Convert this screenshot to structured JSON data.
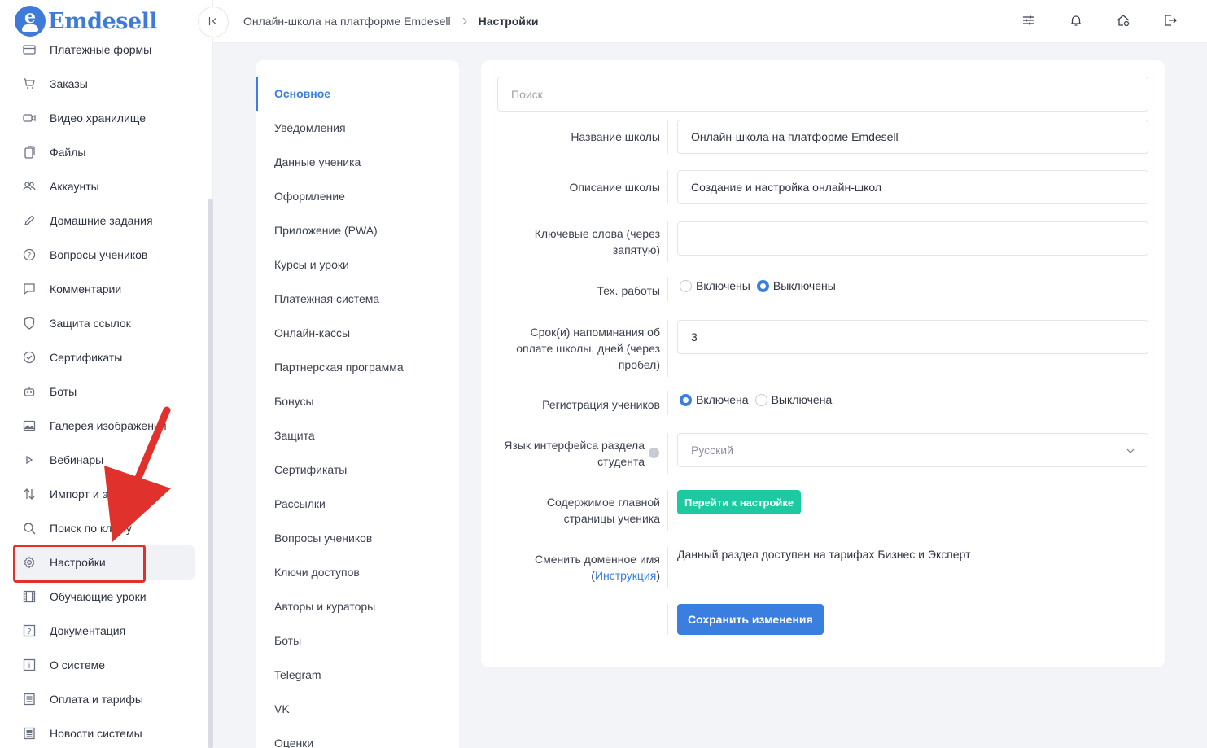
{
  "brand": {
    "name": "Emdesell"
  },
  "sidebar": {
    "items": [
      {
        "label": "Платежные формы",
        "icon": "credit-card-icon"
      },
      {
        "label": "Заказы",
        "icon": "cart-icon"
      },
      {
        "label": "Видео хранилище",
        "icon": "video-icon"
      },
      {
        "label": "Файлы",
        "icon": "files-icon"
      },
      {
        "label": "Аккаунты",
        "icon": "users-icon"
      },
      {
        "label": "Домашние задания",
        "icon": "pencil-icon"
      },
      {
        "label": "Вопросы учеников",
        "icon": "question-icon"
      },
      {
        "label": "Комментарии",
        "icon": "comment-icon"
      },
      {
        "label": "Защита ссылок",
        "icon": "shield-icon"
      },
      {
        "label": "Сертификаты",
        "icon": "certificate-icon"
      },
      {
        "label": "Боты",
        "icon": "bot-icon"
      },
      {
        "label": "Галерея изображений",
        "icon": "image-icon"
      },
      {
        "label": "Вебинары",
        "icon": "play-icon"
      },
      {
        "label": "Импорт и экспорт",
        "icon": "import-export-icon"
      },
      {
        "label": "Поиск по ключу",
        "icon": "search-icon"
      },
      {
        "label": "Настройки",
        "icon": "gear-icon"
      },
      {
        "label": "Обучающие уроки",
        "icon": "film-icon"
      },
      {
        "label": "Документация",
        "icon": "help-box-icon"
      },
      {
        "label": "О системе",
        "icon": "info-box-icon"
      },
      {
        "label": "Оплата и тарифы",
        "icon": "receipt-icon"
      },
      {
        "label": "Новости системы",
        "icon": "news-icon"
      }
    ]
  },
  "header": {
    "breadcrumb": [
      "Онлайн-школа на платформе Emdesell",
      "Настройки"
    ]
  },
  "settings_nav": {
    "items": [
      "Основное",
      "Уведомления",
      "Данные ученика",
      "Оформление",
      "Приложение (PWA)",
      "Курсы и уроки",
      "Платежная система",
      "Онлайн-кассы",
      "Партнерская программа",
      "Бонусы",
      "Защита",
      "Сертификаты",
      "Рассылки",
      "Вопросы учеников",
      "Ключи доступов",
      "Авторы и кураторы",
      "Боты",
      "Telegram",
      "VK",
      "Оценки"
    ]
  },
  "form": {
    "search_placeholder": "Поиск",
    "school_name": {
      "label": "Название школы",
      "value": "Онлайн-школа на платформе Emdesell"
    },
    "school_description": {
      "label": "Описание школы",
      "value": "Создание и настройка онлайн-школ"
    },
    "keywords": {
      "label_1": "Ключевые слова (через",
      "label_2": "запятую)",
      "value": ""
    },
    "maintenance": {
      "label": "Тех. работы",
      "on": "Включены",
      "off": "Выключены"
    },
    "reminders": {
      "label_1": "Срок(и) напоминания об",
      "label_2": "оплате школы, дней (через",
      "label_3": "пробел)",
      "value": "3"
    },
    "registration": {
      "label": "Регистрация учеников",
      "on": "Включена",
      "off": "Выключена"
    },
    "language": {
      "label_1": "Язык интерфейса раздела",
      "label_2": "студента",
      "info": "!",
      "value": "Русский"
    },
    "main_page": {
      "label_1": "Содержимое главной",
      "label_2": "страницы ученика",
      "button": "Перейти к настройке"
    },
    "domain": {
      "label_1": "Сменить доменное имя",
      "paren_open": "(",
      "link": "Инструкция",
      "paren_close": ")",
      "text": "Данный раздел доступен на тарифах Бизнес и Эксперт"
    },
    "save_button": "Сохранить изменения"
  }
}
